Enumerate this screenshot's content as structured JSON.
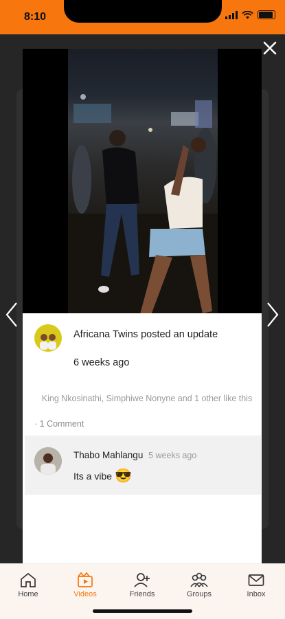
{
  "status": {
    "time": "8:10"
  },
  "post": {
    "author": "Africana Twins",
    "action": "posted an update",
    "time_ago": "6 weeks ago",
    "likes_text": "King Nkosinathi, Simphiwe Nonyne and 1 other like this",
    "comments_link": "· 1 Comment"
  },
  "comment": {
    "name": "Thabo Mahlangu",
    "time_ago": "5 weeks ago",
    "text": "Its a vibe",
    "emoji": "😎"
  },
  "tabs": [
    {
      "label": "Home",
      "icon": "home-icon"
    },
    {
      "label": "Videos",
      "icon": "videos-icon",
      "active": true
    },
    {
      "label": "Friends",
      "icon": "add-friend-icon"
    },
    {
      "label": "Groups",
      "icon": "groups-icon"
    },
    {
      "label": "Inbox",
      "icon": "inbox-icon"
    }
  ],
  "colors": {
    "accent": "#f7760d",
    "tabbar_bg": "#fbf4ef",
    "comment_bg": "#f1f1f1"
  }
}
